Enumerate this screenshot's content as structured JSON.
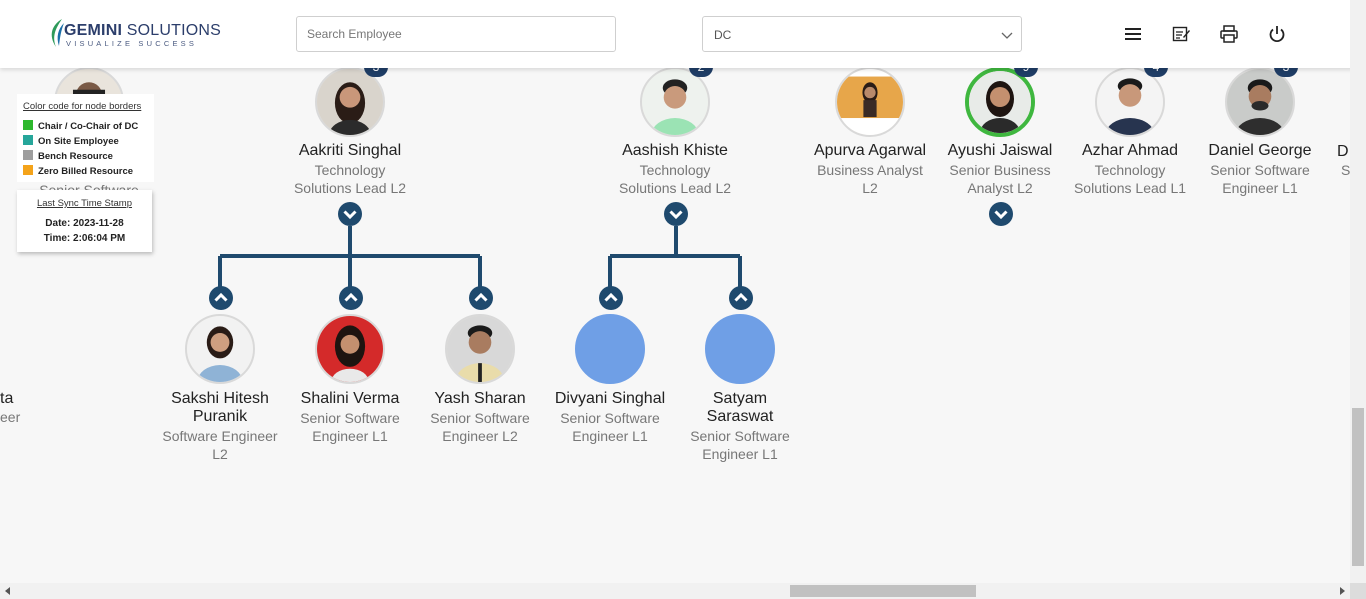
{
  "header": {
    "brand_name": "GEMINI",
    "brand_suffix": "SOLUTIONS",
    "tagline": "VISUALIZE SUCCESS",
    "search": {
      "placeholder": "Search Employee",
      "value": ""
    },
    "department_select": {
      "value": "DC"
    },
    "icons": [
      "menu-icon",
      "notes-icon",
      "print-icon",
      "power-icon"
    ]
  },
  "legend": {
    "title": "Color code for node borders",
    "items": [
      {
        "label": "Chair / Co-Chair of DC",
        "color": "#2db82d"
      },
      {
        "label": "On Site Employee",
        "color": "#26a69a"
      },
      {
        "label": "Bench Resource",
        "color": "#9e9e9e"
      },
      {
        "label": "Zero Billed Resource",
        "color": "#f4a31a"
      }
    ]
  },
  "sync": {
    "title": "Last Sync Time Stamp",
    "date": "Date: 2023-11-28",
    "time": "Time: 2:06:04 PM"
  },
  "partial_left": {
    "role_text": "Senior Software",
    "name_tail": "ta",
    "role_tail": "eer"
  },
  "partial_right": {
    "name_head": "D",
    "role_head": "S"
  },
  "top_row": [
    {
      "name": "Aakriti Singhal",
      "role": [
        "Technology",
        "Solutions Lead L2"
      ],
      "badge": "3"
    },
    {
      "name": "Aashish Khiste",
      "role": [
        "Technology",
        "Solutions Lead L2"
      ],
      "badge": "2"
    },
    {
      "name": "Apurva Agarwal",
      "role": [
        "Business Analyst",
        "L2"
      ],
      "badge": ""
    },
    {
      "name": "Ayushi Jaiswal",
      "role": [
        "Senior Business",
        "Analyst L2"
      ],
      "badge": "9"
    },
    {
      "name": "Azhar Ahmad",
      "role": [
        "Technology",
        "Solutions Lead L1"
      ],
      "badge": "4"
    },
    {
      "name": "Daniel George",
      "role": [
        "Senior Software",
        "Engineer L1"
      ],
      "badge": "3"
    }
  ],
  "children_row": [
    {
      "name": [
        "Sakshi Hitesh",
        "Puranik"
      ],
      "role": [
        "Software Engineer",
        "L2"
      ]
    },
    {
      "name": [
        "Shalini Verma"
      ],
      "role": [
        "Senior Software",
        "Engineer L1"
      ]
    },
    {
      "name": [
        "Yash Sharan"
      ],
      "role": [
        "Senior Software",
        "Engineer L2"
      ]
    },
    {
      "name": [
        "Divyani Singhal"
      ],
      "role": [
        "Senior Software",
        "Engineer L1"
      ]
    },
    {
      "name": [
        "Satyam",
        "Saraswat"
      ],
      "role": [
        "Senior Software",
        "Engineer L1"
      ]
    }
  ],
  "colors": {
    "connector": "#1f4a6e",
    "badge": "#1f3d66",
    "chair_border": "#3fb73f",
    "placeholder_avatar": "#6f9fe6"
  }
}
